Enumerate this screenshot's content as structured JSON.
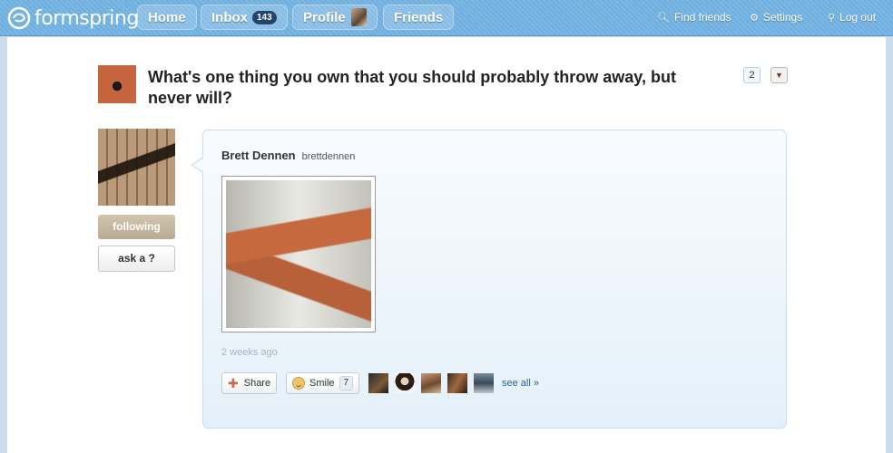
{
  "nav": {
    "logo": "formspring",
    "home": "Home",
    "inbox": "Inbox",
    "inbox_count": "143",
    "profile": "Profile",
    "friends": "Friends",
    "find_friends": "Find friends",
    "settings": "Settings",
    "logout": "Log out"
  },
  "question": {
    "text": "What's one thing you own that you should probably throw away, but never will?",
    "count": "2"
  },
  "sidebar": {
    "following": "following",
    "ask": "ask a ?"
  },
  "answer": {
    "author_name": "Brett Dennen",
    "author_handle": "brettdennen",
    "timestamp": "2 weeks ago",
    "share": "Share",
    "smile": "Smile",
    "smile_count": "7",
    "see_all": "see all »"
  },
  "colors": {
    "topbar": "#7cb8e4",
    "accent_link": "#2b5f9a",
    "following_button": "#c5b8a0"
  },
  "icons": [
    "formspring-logo-icon",
    "search-icon",
    "gear-icon",
    "logout-icon",
    "plus-icon",
    "smile-icon",
    "dropdown-arrow-icon"
  ]
}
